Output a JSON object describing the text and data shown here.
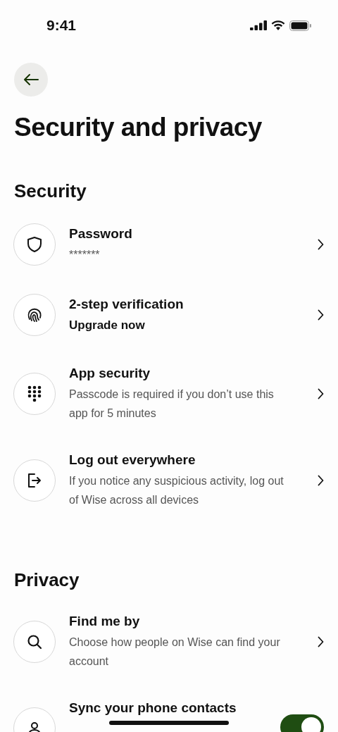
{
  "status_bar": {
    "time": "9:41"
  },
  "title": "Security and privacy",
  "sections": [
    {
      "heading": "Security",
      "items": [
        {
          "kind": "chevron",
          "title": "Password",
          "subtitle": "*******",
          "emphasized": false
        },
        {
          "kind": "chevron",
          "title": "2-step verification",
          "subtitle": "Upgrade now",
          "emphasized": true
        },
        {
          "kind": "chevron",
          "title": "App security",
          "subtitle": "Passcode is required if you don’t use this app for 5 minutes",
          "emphasized": false
        },
        {
          "kind": "chevron",
          "title": "Log out everywhere",
          "subtitle": "If you notice any suspicious activity, log out of Wise across all devices",
          "emphasized": false
        }
      ]
    },
    {
      "heading": "Privacy",
      "items": [
        {
          "kind": "chevron",
          "title": "Find me by",
          "subtitle": "Choose how people on Wise can find your account",
          "emphasized": false
        },
        {
          "kind": "toggle",
          "title": "Sync your phone contacts",
          "on": true
        }
      ]
    }
  ]
}
